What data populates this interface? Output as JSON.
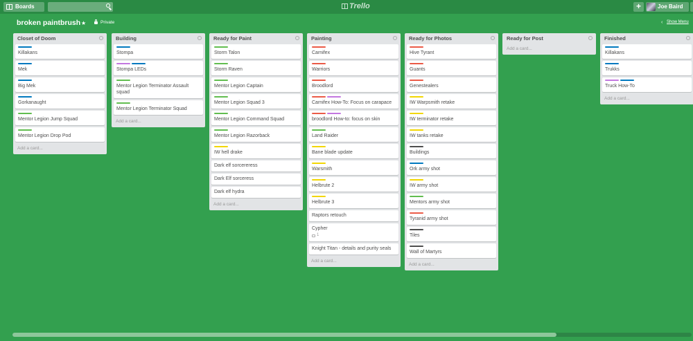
{
  "header": {
    "boards_label": "Boards",
    "logo_text": "Trello",
    "add_label": "+",
    "user_name": "Joe Baird"
  },
  "board": {
    "title": "broken paintbrush",
    "privacy": "Private",
    "show_menu": "Show Menu"
  },
  "label_colors": {
    "blue": "#0079bf",
    "green": "#61bd4f",
    "purple": "#c377e0",
    "red": "#eb5a46",
    "yellow": "#f2d600",
    "black": "#4d4d4d"
  },
  "lists": [
    {
      "name": "Closet of Doom",
      "add_label": "Add a card...",
      "cards": [
        {
          "labels": [
            "blue"
          ],
          "text": "Killakans"
        },
        {
          "labels": [
            "blue"
          ],
          "text": "Mek"
        },
        {
          "labels": [
            "blue"
          ],
          "text": "Big Mek"
        },
        {
          "labels": [
            "blue"
          ],
          "text": "Gorkanaught"
        },
        {
          "labels": [
            "green"
          ],
          "text": "Mentor Legion Jump Squad"
        },
        {
          "labels": [
            "green"
          ],
          "text": "Mentor Legion Drop Pod"
        }
      ]
    },
    {
      "name": "Building",
      "add_label": "Add a card...",
      "cards": [
        {
          "labels": [
            "blue"
          ],
          "text": "Stompa"
        },
        {
          "labels": [
            "purple",
            "blue"
          ],
          "text": "Stompa LEDs"
        },
        {
          "labels": [
            "green"
          ],
          "text": "Mentor Legion Terminator Assault squad"
        },
        {
          "labels": [
            "green"
          ],
          "text": "Mentor Legion Terminator Squad"
        }
      ]
    },
    {
      "name": "Ready for Paint",
      "add_label": "Add a card...",
      "cards": [
        {
          "labels": [
            "green"
          ],
          "text": "Storm Talon"
        },
        {
          "labels": [
            "green"
          ],
          "text": "Storm Raven"
        },
        {
          "labels": [
            "green"
          ],
          "text": "Mentor Legion Captain"
        },
        {
          "labels": [
            "green"
          ],
          "text": "Mentor Legion Squad 3"
        },
        {
          "labels": [
            "green"
          ],
          "text": "Mentor Legion Command Squad"
        },
        {
          "labels": [
            "green"
          ],
          "text": "Mentor Legion Razorback"
        },
        {
          "labels": [
            "yellow"
          ],
          "text": "IW hell drake"
        },
        {
          "labels": [],
          "text": "Dark elf sorcereress"
        },
        {
          "labels": [],
          "text": "Dark Elf sorceress"
        },
        {
          "labels": [],
          "text": "Dark elf hydra"
        }
      ]
    },
    {
      "name": "Painting",
      "add_label": "Add a card...",
      "cards": [
        {
          "labels": [
            "red"
          ],
          "text": "Carnifex"
        },
        {
          "labels": [
            "red"
          ],
          "text": "Warriors"
        },
        {
          "labels": [
            "red"
          ],
          "text": "Broodlord"
        },
        {
          "labels": [
            "red",
            "purple"
          ],
          "text": "Carnifex How-To: Focus on carapace"
        },
        {
          "labels": [
            "red",
            "purple"
          ],
          "text": "broodlord How-to: focus on skin"
        },
        {
          "labels": [
            "green"
          ],
          "text": "Land Raider"
        },
        {
          "labels": [
            "yellow"
          ],
          "text": "Bane blade update"
        },
        {
          "labels": [
            "yellow"
          ],
          "text": "Warsmith"
        },
        {
          "labels": [
            "yellow"
          ],
          "text": "Helbrute 2"
        },
        {
          "labels": [
            "yellow"
          ],
          "text": "Helbrute 3"
        },
        {
          "labels": [],
          "text": "Raptors retouch"
        },
        {
          "labels": [],
          "text": "Cypher",
          "comments": "1"
        },
        {
          "labels": [],
          "text": "Knight Titan - details and purity seals"
        }
      ]
    },
    {
      "name": "Ready for Photos",
      "add_label": "Add a card...",
      "cards": [
        {
          "labels": [
            "red"
          ],
          "text": "Hive Tyrant"
        },
        {
          "labels": [
            "red"
          ],
          "text": "Guants"
        },
        {
          "labels": [
            "red"
          ],
          "text": "Genestealers"
        },
        {
          "labels": [
            "yellow"
          ],
          "text": "IW Warpsmith retake"
        },
        {
          "labels": [
            "yellow"
          ],
          "text": "IW terminator retake"
        },
        {
          "labels": [
            "yellow"
          ],
          "text": "IW tanks retake"
        },
        {
          "labels": [
            "black"
          ],
          "text": "Buildings"
        },
        {
          "labels": [
            "blue"
          ],
          "text": "Ork army shot"
        },
        {
          "labels": [
            "yellow"
          ],
          "text": "IW army shot"
        },
        {
          "labels": [
            "green"
          ],
          "text": "Mentors army shot"
        },
        {
          "labels": [
            "red"
          ],
          "text": "Tyranid army shot"
        },
        {
          "labels": [
            "black"
          ],
          "text": "Tiles"
        },
        {
          "labels": [
            "black"
          ],
          "text": "Wall of Martyrs"
        }
      ]
    },
    {
      "name": "Ready for Post",
      "add_label": "Add a card...",
      "cards": []
    },
    {
      "name": "Finished",
      "add_label": "Add a card...",
      "cards": [
        {
          "labels": [
            "blue"
          ],
          "text": "Killakans"
        },
        {
          "labels": [
            "blue"
          ],
          "text": "Trukks"
        },
        {
          "labels": [
            "purple",
            "blue"
          ],
          "text": "Truck How-To"
        }
      ]
    }
  ]
}
